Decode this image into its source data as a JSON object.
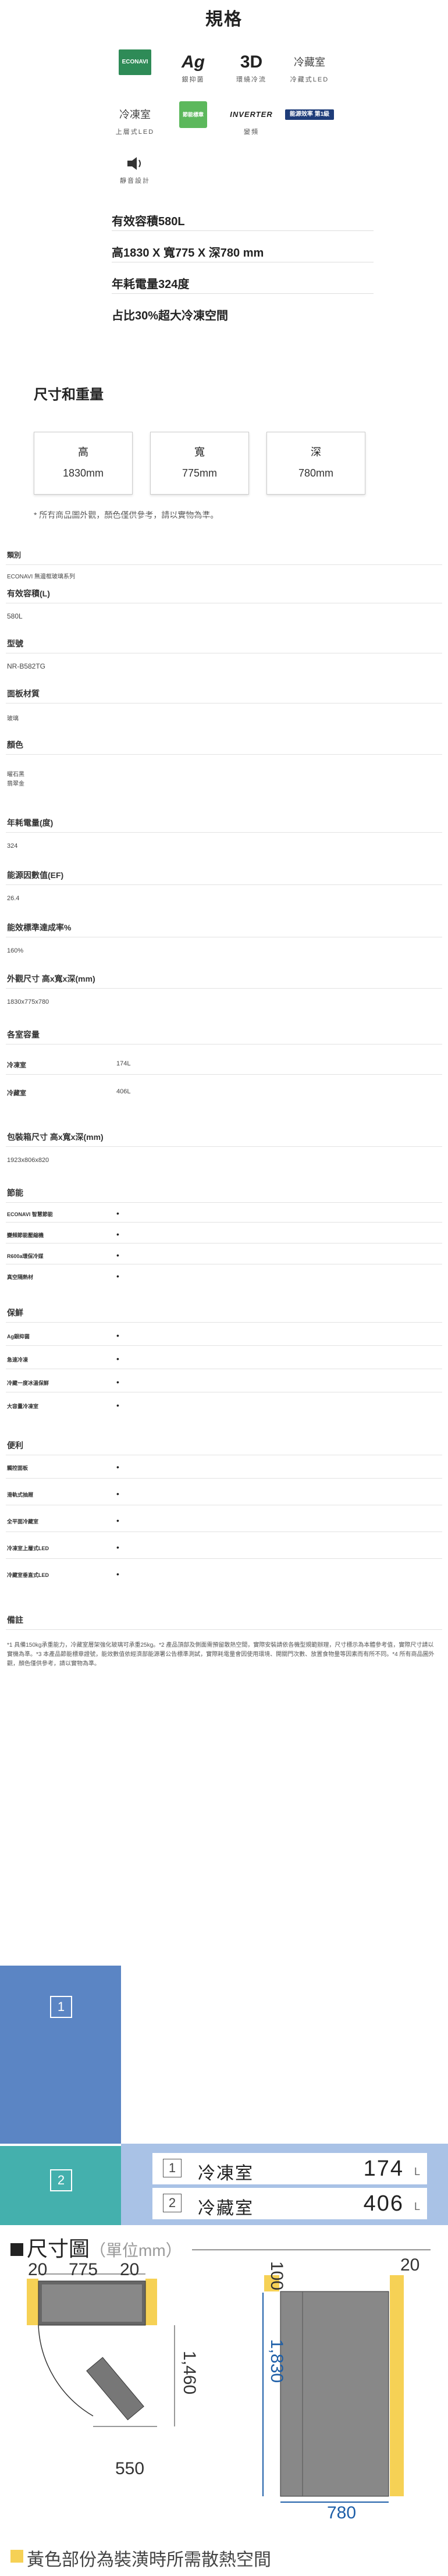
{
  "title": "規格",
  "badges": [
    {
      "icon": "econavi-icon",
      "text": "ECONAVI",
      "label": ""
    },
    {
      "icon": "ag-icon",
      "text": "Ag",
      "label": "銀抑菌"
    },
    {
      "icon": "3d-icon",
      "text": "3D",
      "label": "環繞冷流"
    },
    {
      "icon": "fridge-led-icon",
      "text": "冷藏室",
      "label": "冷藏式LED"
    },
    {
      "icon": "freezer-led-icon",
      "text": "冷凍室",
      "label": "上層式LED"
    },
    {
      "icon": "energy-icon",
      "text": "節能標章",
      "label": ""
    },
    {
      "icon": "inverter-icon",
      "text": "INVERTER",
      "label": "變頻"
    },
    {
      "icon": "rank-icon",
      "text": "能源效率 第1級",
      "label": ""
    },
    {
      "icon": "quiet-icon",
      "text": "))",
      "label": "靜音設計"
    }
  ],
  "highlights": [
    "有效容積580L",
    "高1830 X 寬775 X 深780 mm",
    "年耗電量324度",
    "占比30%超大冷凍空間"
  ],
  "dimensions": {
    "heading": "尺寸和重量",
    "items": [
      {
        "label": "高",
        "value": "1830mm"
      },
      {
        "label": "寬",
        "value": "775mm"
      },
      {
        "label": "深",
        "value": "780mm"
      }
    ],
    "note": "* 所有商品圖外觀，顏色僅供參考，請以實物為準。"
  },
  "specs": {
    "category_label": "類別",
    "category_value": "ECONAVI 無邊框玻璃系列",
    "capacity_label": "有效容積(L)",
    "capacity_value": "580L",
    "model_label": "型號",
    "model_value": "NR-B582TG",
    "panel_label": "面板材質",
    "panel_value": "玻璃",
    "color_label": "顏色",
    "color_values": [
      "曜石黑",
      "翡翠金"
    ],
    "power_label": "年耗電量(度)",
    "power_value": "324",
    "ef_label": "能源因數值(EF)",
    "ef_value": "26.4",
    "rate_label": "能效標準達成率%",
    "rate_value": "160%",
    "outer_label": "外觀尺寸 高x寬x深(mm)",
    "outer_value": "1830x775x780",
    "compartment_label": "各室容量",
    "compartments": [
      {
        "name": "冷凍室",
        "value": "174L"
      },
      {
        "name": "冷藏室",
        "value": "406L"
      }
    ],
    "package_label": "包裝箱尺寸 高x寬x深(mm)",
    "package_value": "1923x806x820",
    "eco_label": "節能",
    "eco_items": [
      "ECONAVI 智慧節能",
      "變頻節能壓縮機",
      "R600a環保冷媒",
      "真空隔熱材"
    ],
    "protect_label": "保鮮",
    "protect_items": [
      "Ag銀抑菌",
      "急速冷凍",
      "冷藏一度冰溫保鮮",
      "大容量冷凍室"
    ],
    "convenience_label": "便利",
    "convenience_items": [
      "觸控面板",
      "滑軌式抽屜",
      "全平面冷藏室",
      "冷凍室上層式LED",
      "冷藏室垂直式LED"
    ],
    "remarks_label": "備註",
    "remarks_text": "*1 具備150kg承重能力，冷藏室層架強化玻璃可承重25kg。*2 產品頂部及側面需預留散熱空間，實際安裝請依各機型規範辦理，尺寸標示為本體參考值，實際尺寸請以實機為準。*3 本產品節能標章證號，能效數值依經濟部能源署公告標準測試，實際耗電量會因使用環境、開關門次數、放置食物量等因素而有所不同。*4 所有商品圖外觀，顏色僅供參考，請以實物為準。"
  },
  "graphic": {
    "compartments": [
      {
        "num": "1",
        "name": "冷凍室",
        "volume": "174",
        "unit": "L"
      },
      {
        "num": "2",
        "name": "冷藏室",
        "volume": "406",
        "unit": "L"
      }
    ],
    "drawing_title": "尺寸圖",
    "drawing_unit": "（單位mm）",
    "dims": {
      "left_top": "20",
      "width": "775",
      "right_top": "20",
      "depth_open": "1,460",
      "bottom_width": "550",
      "top_gap": "100",
      "side_gap": "20",
      "height": "1,830",
      "depth": "780"
    },
    "heat_note": "黃色部份為裝潢時所需散熱空間",
    "colors": {
      "freezer": "#5b85c4",
      "fridge": "#44b0ad",
      "band": "#a9c2e6"
    }
  }
}
